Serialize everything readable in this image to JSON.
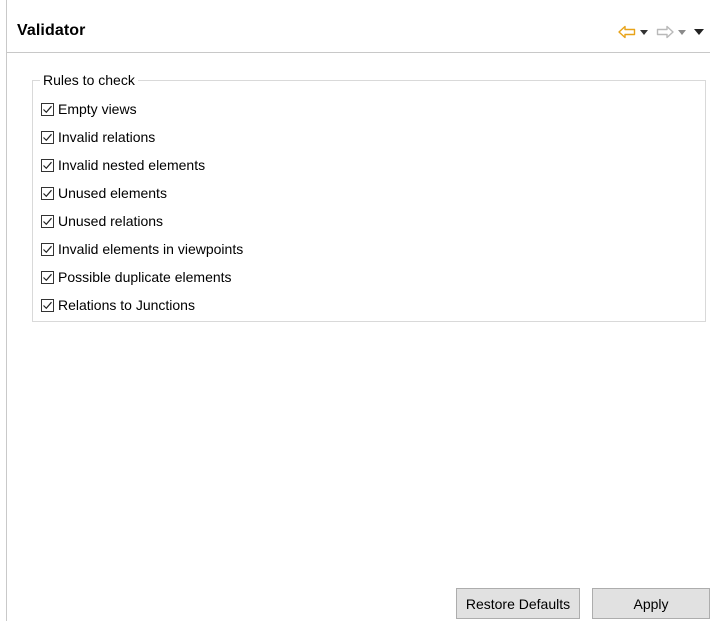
{
  "header": {
    "title": "Validator"
  },
  "nav": {
    "back_icon": "back-arrow-icon",
    "forward_icon": "forward-arrow-icon",
    "menu_icon": "view-menu-icon",
    "back_color": "#e8a319",
    "forward_color": "#b9b9b9",
    "caret_color": "#333333"
  },
  "group": {
    "title": "Rules to check",
    "rules": [
      {
        "label": "Empty views",
        "checked": true
      },
      {
        "label": "Invalid relations",
        "checked": true
      },
      {
        "label": "Invalid nested elements",
        "checked": true
      },
      {
        "label": "Unused elements",
        "checked": true
      },
      {
        "label": "Unused relations",
        "checked": true
      },
      {
        "label": "Invalid elements in viewpoints",
        "checked": true
      },
      {
        "label": "Possible duplicate elements",
        "checked": true
      },
      {
        "label": "Relations to Junctions",
        "checked": true
      }
    ]
  },
  "buttons": {
    "restore_defaults": "Restore Defaults",
    "apply": "Apply"
  }
}
